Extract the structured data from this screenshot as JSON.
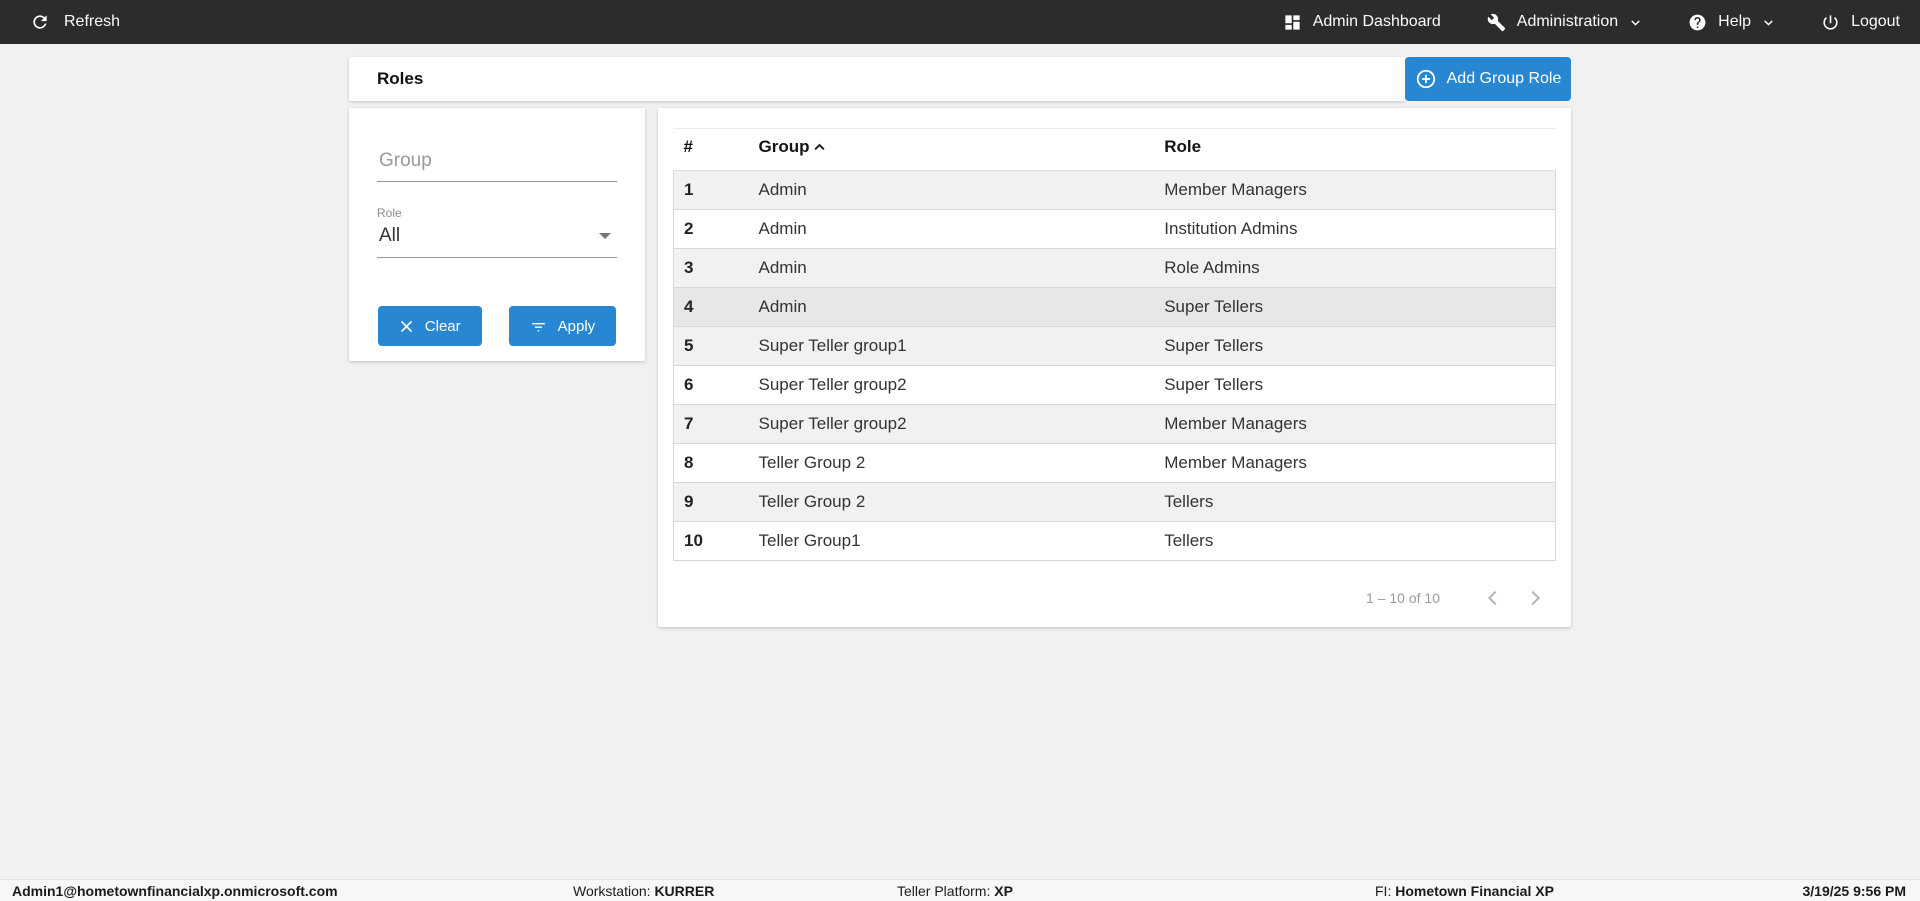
{
  "topbar": {
    "refresh_label": "Refresh",
    "items": [
      {
        "label": "Admin Dashboard",
        "icon": "dashboard-icon",
        "has_chevron": false
      },
      {
        "label": "Administration",
        "icon": "wrench-icon",
        "has_chevron": true
      },
      {
        "label": "Help",
        "icon": "help-icon",
        "has_chevron": true
      },
      {
        "label": "Logout",
        "icon": "power-icon",
        "has_chevron": false
      }
    ]
  },
  "toolbar": {
    "title": "Roles",
    "add_button_label": "Add Group Role"
  },
  "filters": {
    "group_placeholder": "Group",
    "group_value": "",
    "role_label": "Role",
    "role_value": "All",
    "clear_button": "Clear",
    "apply_button": "Apply"
  },
  "table": {
    "columns": {
      "num": "#",
      "group": "Group",
      "role": "Role"
    },
    "sorted_column": "Group",
    "sort_direction": "ascending",
    "rows": [
      {
        "num": "1",
        "group": "Admin",
        "role": "Member Managers",
        "highlighted": false
      },
      {
        "num": "2",
        "group": "Admin",
        "role": "Institution Admins",
        "highlighted": false
      },
      {
        "num": "3",
        "group": "Admin",
        "role": "Role Admins",
        "highlighted": false
      },
      {
        "num": "4",
        "group": "Admin",
        "role": "Super Tellers",
        "highlighted": true
      },
      {
        "num": "5",
        "group": "Super Teller group1",
        "role": "Super Tellers",
        "highlighted": false
      },
      {
        "num": "6",
        "group": "Super Teller group2",
        "role": "Super Tellers",
        "highlighted": false
      },
      {
        "num": "7",
        "group": "Super Teller group2",
        "role": "Member Managers",
        "highlighted": false
      },
      {
        "num": "8",
        "group": "Teller Group 2",
        "role": "Member Managers",
        "highlighted": false
      },
      {
        "num": "9",
        "group": "Teller Group 2",
        "role": "Tellers",
        "highlighted": false
      },
      {
        "num": "10",
        "group": "Teller Group1",
        "role": "Tellers",
        "highlighted": false
      }
    ]
  },
  "pagination": {
    "range_text": "1 – 10 of 10"
  },
  "statusbar": {
    "user": "Admin1@hometownfinancialxp.onmicrosoft.com",
    "workstation_label": "Workstation:",
    "workstation_value": "KURRER",
    "platform_label": "Teller Platform:",
    "platform_value": "XP",
    "fi_label": "FI:",
    "fi_value": "Hometown Financial XP",
    "datetime": "3/19/25 9:56 PM"
  },
  "colors": {
    "accent_blue": "#2787d3",
    "topbar_bg": "#2c2c2c",
    "row_stripe": "#f1f1f1",
    "row_highlight": "#e7e7e7"
  }
}
